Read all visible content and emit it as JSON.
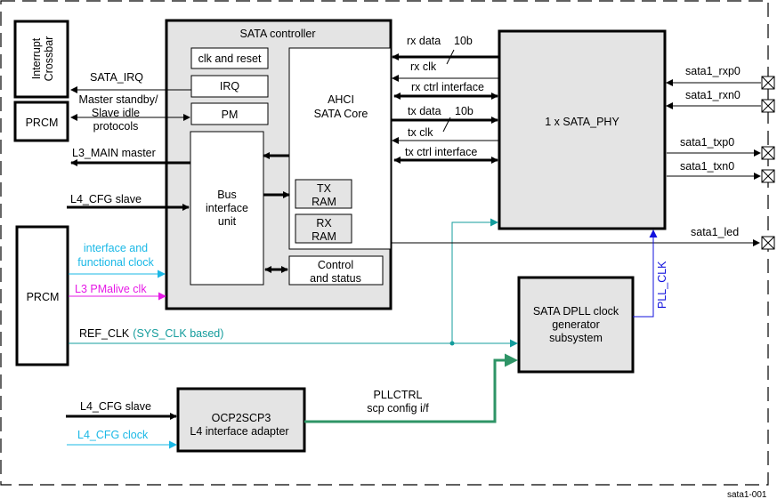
{
  "figure_id": "sata1-001",
  "colors": {
    "black": "#000000",
    "box_fill": "#e4e4e4",
    "cyan_clock": "#1ab8e6",
    "magenta_clock": "#e619e6",
    "teal_refclk": "#139c9c",
    "blue_pllclk": "#1111dd",
    "green_pllctrl": "#2e9466"
  },
  "blocks": {
    "interrupt_crossbar": {
      "line1": "Interrupt",
      "line2": "Crossbar"
    },
    "prcm_top": "PRCM",
    "prcm_bottom": "PRCM",
    "sata_controller": {
      "title": "SATA controller",
      "clk_and_reset": "clk and reset",
      "irq": "IRQ",
      "pm": "PM",
      "bus_interface_unit": [
        "Bus",
        "interface",
        "unit"
      ],
      "ahci_core": [
        "AHCI",
        "SATA Core"
      ],
      "tx_ram": [
        "TX",
        "RAM"
      ],
      "rx_ram": [
        "RX",
        "RAM"
      ],
      "control_status": [
        "Control",
        "and status"
      ]
    },
    "sata_phy": "1 x SATA_PHY",
    "dpll": [
      "SATA DPLL clock",
      "generator",
      "subsystem"
    ],
    "ocp2scp3": [
      "OCP2SCP3",
      "L4 interface adapter"
    ]
  },
  "signals": {
    "sata_irq": "SATA_IRQ",
    "master_standby": [
      "Master standby/",
      "Slave idle",
      "protocols"
    ],
    "l3_main_master": "L3_MAIN master",
    "l4_cfg_slave_top": "L4_CFG  slave",
    "iface_func_clock": [
      "interface and",
      "functional clock"
    ],
    "l3_pmalive_clk": "L3 PMalive clk",
    "ref_clk": "REF_CLK",
    "ref_clk_note": "(SYS_CLK based)",
    "l4_cfg_slave_bottom": "L4_CFG slave",
    "l4_cfg_clock": "L4_CFG clock",
    "pllctrl": [
      "PLLCTRL",
      "scp config i/f"
    ],
    "pll_clk": "PLL_CLK",
    "rx_data": "rx data",
    "rx_data_width": "10b",
    "rx_clk": "rx clk",
    "rx_ctrl": "rx ctrl  interface",
    "tx_data": "tx data",
    "tx_data_width": "10b",
    "tx_clk": "tx clk",
    "tx_ctrl": "tx ctrl  interface"
  },
  "pins": [
    "sata1_rxp0",
    "sata1_rxn0",
    "sata1_txp0",
    "sata1_txn0",
    "sata1_led"
  ]
}
